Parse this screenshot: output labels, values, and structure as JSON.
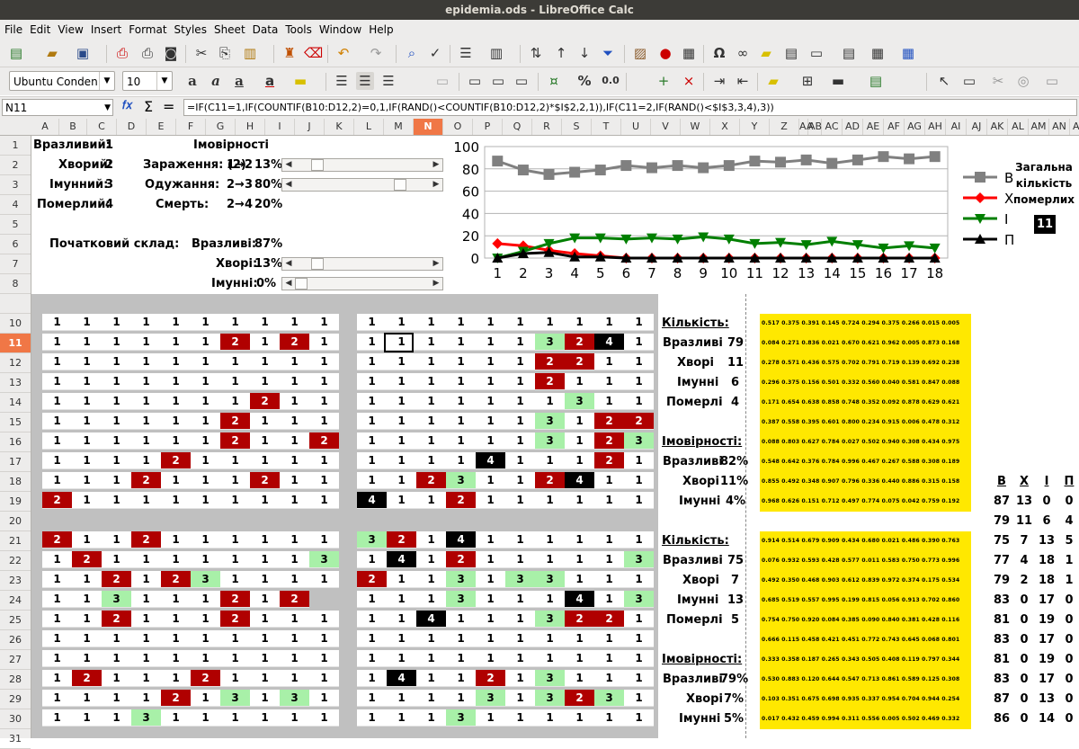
{
  "window": {
    "title": "epidemia.ods - LibreOffice Calc"
  },
  "menu": [
    "File",
    "Edit",
    "View",
    "Insert",
    "Format",
    "Styles",
    "Sheet",
    "Data",
    "Tools",
    "Window",
    "Help"
  ],
  "toolbar": {
    "font_name": "Ubuntu Conden",
    "font_size": "10",
    "percent": "%",
    "number_format": "0.0"
  },
  "formula_bar": {
    "cell_ref": "N11",
    "fx": "𝑓𝑥",
    "sum": "Σ",
    "eq": "=",
    "formula": "=IF(C11=1,IF(COUNTIF(B10:D12,2)=0,1,IF(RAND()<COUNTIF(B10:D12,2)*$I$2,2,1)),IF(C11=2,IF(RAND()<$I$3,3,4),3))"
  },
  "columns": [
    "A",
    "B",
    "C",
    "D",
    "E",
    "F",
    "G",
    "H",
    "I",
    "J",
    "K",
    "L",
    "M",
    "N",
    "O",
    "P",
    "Q",
    "R",
    "S",
    "T",
    "U",
    "V",
    "W",
    "X",
    "Y",
    "Z",
    "AA",
    "AB",
    "AC",
    "AD",
    "AE",
    "AF",
    "AG",
    "AH",
    "AI",
    "AJ",
    "AK",
    "AL",
    "AM",
    "AN",
    "AO",
    "AP"
  ],
  "rows": [
    "1",
    "2",
    "3",
    "4",
    "5",
    "6",
    "7",
    "8",
    "",
    "10",
    "11",
    "12",
    "13",
    "14",
    "15",
    "16",
    "17",
    "18",
    "19",
    "20",
    "21",
    "22",
    "23",
    "24",
    "25",
    "26",
    "27",
    "28",
    "29",
    "30",
    "31"
  ],
  "params": {
    "vulnerable_label": "Вразливий:",
    "vulnerable_code": "1",
    "sick_label": "Хворий:",
    "sick_code": "2",
    "immune_label": "Імунний:",
    "immune_code": "3",
    "dead_label": "Померлий:",
    "dead_code": "4",
    "prob_title": "Імовірності",
    "infection_label": "Зараження: (2)",
    "infection_trans": "1→2",
    "infection_val": "13%",
    "recovery_label": "Одужання:",
    "recovery_trans": "2→3",
    "recovery_val": "80%",
    "death_label": "Смерть:",
    "death_trans": "2→4",
    "death_val": "20%",
    "initial_label": "Початковий склад:",
    "init_vuln_label": "Вразливі:",
    "init_vuln_val": "87%",
    "init_sick_label": "Хворі:",
    "init_sick_val": "13%",
    "init_imm_label": "Імунні:",
    "init_imm_val": "0%"
  },
  "scrollbars": {
    "infection": 0.13,
    "recovery": 0.8,
    "init_sick": 0.13,
    "init_imm": 0.0
  },
  "chart_data": {
    "type": "line",
    "x": [
      1,
      2,
      3,
      4,
      5,
      6,
      7,
      8,
      9,
      10,
      11,
      12,
      13,
      14,
      15,
      16,
      17,
      18
    ],
    "ylim": [
      0,
      100
    ],
    "yticks": [
      0,
      20,
      40,
      60,
      80,
      100
    ],
    "legend_position": "right",
    "series": [
      {
        "name": "В",
        "color": "#808080",
        "marker": "square",
        "values": [
          87,
          79,
          75,
          77,
          79,
          83,
          81,
          83,
          81,
          83,
          87,
          86,
          88,
          85,
          88,
          91,
          89,
          91
        ]
      },
      {
        "name": "Х",
        "color": "#ff0000",
        "marker": "diamond",
        "values": [
          13,
          11,
          7,
          4,
          2,
          0,
          0,
          0,
          0,
          0,
          0,
          0,
          0,
          0,
          0,
          0,
          0,
          0
        ]
      },
      {
        "name": "І",
        "color": "#007f00",
        "marker": "triangle-down",
        "values": [
          0,
          6,
          13,
          18,
          18,
          17,
          18,
          17,
          19,
          17,
          13,
          14,
          12,
          15,
          12,
          9,
          11,
          9
        ]
      },
      {
        "name": "П",
        "color": "#000000",
        "marker": "triangle-up",
        "values": [
          0,
          4,
          5,
          1,
          1,
          0,
          0,
          0,
          0,
          0,
          0,
          0,
          0,
          0,
          0,
          0,
          0,
          0
        ]
      }
    ]
  },
  "total_dead": {
    "label": "Загальна кількість померлих",
    "value": "11"
  },
  "grids": {
    "g1": [
      [
        1,
        1,
        1,
        1,
        1,
        1,
        1,
        1,
        1,
        1
      ],
      [
        1,
        1,
        1,
        1,
        1,
        1,
        2,
        1,
        2,
        1
      ],
      [
        1,
        1,
        1,
        1,
        1,
        1,
        1,
        1,
        1,
        1
      ],
      [
        1,
        1,
        1,
        1,
        1,
        1,
        1,
        1,
        1,
        1
      ],
      [
        1,
        1,
        1,
        1,
        1,
        1,
        1,
        2,
        1,
        1
      ],
      [
        1,
        1,
        1,
        1,
        1,
        1,
        2,
        1,
        1,
        1
      ],
      [
        1,
        1,
        1,
        1,
        1,
        1,
        2,
        1,
        1,
        2
      ],
      [
        1,
        1,
        1,
        1,
        2,
        1,
        1,
        1,
        1,
        1
      ],
      [
        1,
        1,
        1,
        2,
        1,
        1,
        1,
        2,
        1,
        1
      ],
      [
        2,
        1,
        1,
        1,
        1,
        1,
        1,
        1,
        1,
        1
      ]
    ],
    "g2": [
      [
        1,
        1,
        1,
        1,
        1,
        1,
        1,
        1,
        1,
        1
      ],
      [
        1,
        1,
        1,
        1,
        1,
        1,
        3,
        2,
        4,
        1
      ],
      [
        1,
        1,
        1,
        1,
        1,
        1,
        2,
        2,
        1,
        1
      ],
      [
        1,
        1,
        1,
        1,
        1,
        1,
        2,
        1,
        1,
        1
      ],
      [
        1,
        1,
        1,
        1,
        1,
        1,
        1,
        3,
        1,
        1
      ],
      [
        1,
        1,
        1,
        1,
        1,
        1,
        3,
        1,
        2,
        2
      ],
      [
        1,
        1,
        1,
        1,
        1,
        1,
        3,
        1,
        2,
        3
      ],
      [
        1,
        1,
        1,
        1,
        4,
        1,
        1,
        1,
        2,
        1
      ],
      [
        1,
        1,
        2,
        3,
        1,
        1,
        2,
        4,
        1,
        1
      ],
      [
        4,
        1,
        1,
        2,
        1,
        1,
        1,
        1,
        1,
        1
      ]
    ],
    "g3": [
      [
        2,
        1,
        1,
        2,
        1,
        1,
        1,
        1,
        1,
        1
      ],
      [
        1,
        2,
        1,
        1,
        1,
        1,
        1,
        1,
        1,
        3
      ],
      [
        1,
        1,
        2,
        1,
        2,
        3,
        1,
        1,
        1,
        1
      ],
      [
        1,
        1,
        3,
        1,
        1,
        1,
        2,
        1,
        2
      ],
      [
        1,
        1,
        2,
        1,
        1,
        1,
        2,
        1,
        1,
        1
      ],
      [
        1,
        1,
        1,
        1,
        1,
        1,
        1,
        1,
        1,
        1
      ],
      [
        1,
        1,
        1,
        1,
        1,
        1,
        1,
        1,
        1,
        1
      ],
      [
        1,
        2,
        1,
        1,
        1,
        2,
        1,
        1,
        1,
        1
      ],
      [
        1,
        1,
        1,
        1,
        2,
        1,
        3,
        1,
        3,
        1
      ],
      [
        1,
        1,
        1,
        3,
        1,
        1,
        1,
        1,
        1,
        1
      ]
    ],
    "g4": [
      [
        3,
        2,
        1,
        4,
        1,
        1,
        1,
        1,
        1,
        1
      ],
      [
        1,
        4,
        1,
        2,
        1,
        1,
        1,
        1,
        1,
        3
      ],
      [
        2,
        1,
        1,
        3,
        1,
        3,
        3,
        1,
        1,
        1
      ],
      [
        1,
        1,
        1,
        3,
        1,
        1,
        1,
        4,
        1,
        3
      ],
      [
        1,
        1,
        4,
        1,
        1,
        1,
        3,
        2,
        2,
        1
      ],
      [
        1,
        1,
        1,
        1,
        1,
        1,
        1,
        1,
        1,
        1
      ],
      [
        1,
        1,
        1,
        1,
        1,
        1,
        1,
        1,
        1,
        1
      ],
      [
        1,
        4,
        1,
        1,
        2,
        1,
        3,
        1,
        1,
        1
      ],
      [
        1,
        1,
        1,
        1,
        3,
        1,
        3,
        2,
        3,
        1
      ],
      [
        1,
        1,
        1,
        3,
        1,
        1,
        1,
        1,
        1,
        1
      ]
    ]
  },
  "stats_top": {
    "count_title": "Кількість:",
    "vuln_label": "Вразливі",
    "vuln": "79",
    "sick_label": "Хворі",
    "sick": "11",
    "imm_label": "Імунні",
    "imm": "6",
    "dead_label": "Померлі",
    "dead": "4",
    "prob_title": "Імовірності:",
    "p_vuln_label": "Вразливі",
    "p_vuln": "82%",
    "p_sick_label": "Хворі",
    "p_sick": "11%",
    "p_imm_label": "Імунні",
    "p_imm": "4%"
  },
  "stats_bottom": {
    "count_title": "Кількість:",
    "vuln_label": "Вразливі",
    "vuln": "75",
    "sick_label": "Хворі",
    "sick": "7",
    "imm_label": "Імунні",
    "imm": "13",
    "dead_label": "Померлі",
    "dead": "5",
    "prob_title": "Імовірності:",
    "p_vuln_label": "Вразливі",
    "p_vuln": "79%",
    "p_sick_label": "Хворі",
    "p_sick": "7%",
    "p_imm_label": "Імунні",
    "p_imm": "5%"
  },
  "random_rows_top": [
    "0.517 0.375 0.391 0.145 0.724 0.294 0.375 0.266 0.015 0.005",
    "0.084 0.271 0.836 0.021 0.670 0.621 0.962 0.005 0.873 0.168",
    "0.278 0.571 0.436 0.575 0.702 0.791 0.719 0.139 0.692 0.238",
    "0.296 0.375 0.156 0.501 0.332 0.560 0.040 0.581 0.847 0.088",
    "0.171 0.654 0.638 0.858 0.748 0.352 0.092 0.878 0.629 0.621",
    "0.387 0.558 0.395 0.601 0.800 0.234 0.915 0.006 0.478 0.312",
    "0.088 0.803 0.627 0.784 0.027 0.502 0.940 0.308 0.434 0.975",
    "0.548 0.642 0.376 0.784 0.996 0.467 0.267 0.588 0.308 0.189",
    "0.855 0.492 0.348 0.907 0.796 0.336 0.440 0.886 0.315 0.158",
    "0.968 0.626 0.151 0.712 0.497 0.774 0.075 0.042 0.759 0.192"
  ],
  "random_rows_bottom": [
    "0.914 0.514 0.679 0.909 0.434 0.680 0.021 0.486 0.390 0.763",
    "0.076 0.932 0.593 0.428 0.577 0.011 0.583 0.750 0.773 0.996",
    "0.492 0.350 0.468 0.903 0.612 0.839 0.972 0.374 0.175 0.534",
    "0.685 0.519 0.557 0.995 0.199 0.815 0.056 0.913 0.702 0.860",
    "0.754 0.750 0.920 0.084 0.385 0.090 0.840 0.381 0.428 0.116",
    "0.666 0.115 0.458 0.421 0.451 0.772 0.743 0.645 0.068 0.801",
    "0.333 0.358 0.187 0.265 0.343 0.505 0.408 0.119 0.797 0.344",
    "0.530 0.883 0.120 0.644 0.547 0.713 0.861 0.589 0.125 0.308",
    "0.103 0.351 0.675 0.698 0.935 0.337 0.954 0.704 0.944 0.254",
    "0.017 0.432 0.459 0.994 0.311 0.556 0.005 0.502 0.469 0.332"
  ],
  "history": {
    "headers": [
      "В",
      "Х",
      "І",
      "П"
    ],
    "rows": [
      [
        "87",
        "13",
        "0",
        "0"
      ],
      [
        "79",
        "11",
        "6",
        "4"
      ],
      [
        "75",
        "7",
        "13",
        "5"
      ],
      [
        "77",
        "4",
        "18",
        "1"
      ],
      [
        "79",
        "2",
        "18",
        "1"
      ],
      [
        "83",
        "0",
        "17",
        "0"
      ],
      [
        "81",
        "0",
        "19",
        "0"
      ],
      [
        "83",
        "0",
        "17",
        "0"
      ],
      [
        "81",
        "0",
        "19",
        "0"
      ],
      [
        "83",
        "0",
        "17",
        "0"
      ],
      [
        "87",
        "0",
        "13",
        "0"
      ],
      [
        "86",
        "0",
        "14",
        "0"
      ]
    ]
  }
}
